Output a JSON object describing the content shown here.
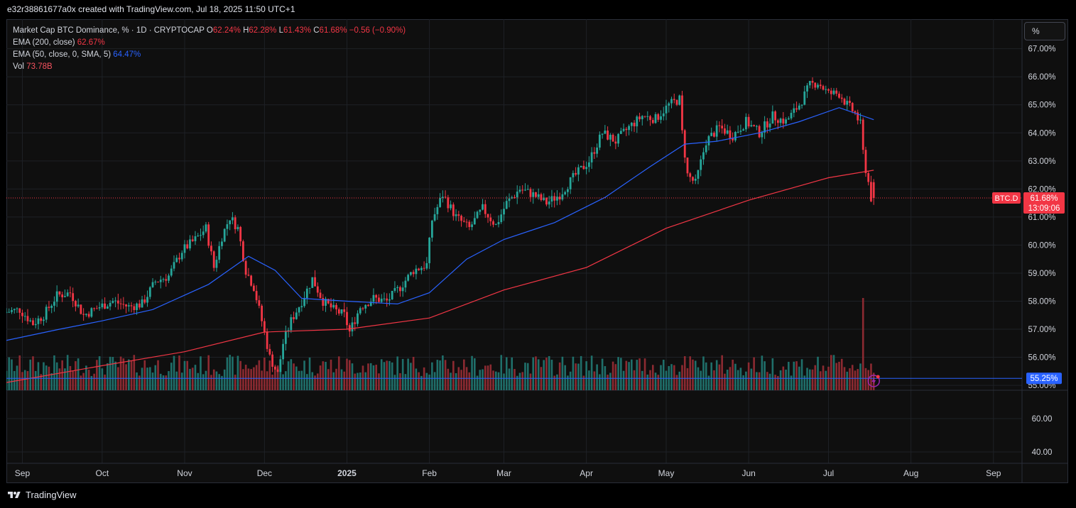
{
  "header": {
    "caption": "e32r38861677a0x created with TradingView.com, Jul 18, 2025 11:50 UTC+1"
  },
  "legend": {
    "symbol": "Market Cap BTC Dominance, % · 1D · CRYPTOCAP",
    "o_label": "O",
    "o_value": "62.24%",
    "h_label": "H",
    "h_value": "62.28%",
    "l_label": "L",
    "l_value": "61.43%",
    "c_label": "C",
    "c_value": "61.68%",
    "change": "−0.56 (−0.90%)",
    "ema200_label": "EMA (200, close)",
    "ema200_value": "62.67%",
    "ema50_label": "EMA (50, close, 0, SMA, 5)",
    "ema50_value": "64.47%",
    "vol_label": "Vol",
    "vol_value": "73.78B"
  },
  "unit_button": "%",
  "footer": {
    "brand": "TradingView"
  },
  "colors": {
    "up": "#26a69a",
    "down": "#f23645",
    "ema200": "#f23645",
    "ema50": "#2962ff",
    "hline": "#2962ff",
    "vol_up": "#1f6f6a",
    "vol_down": "#8c2a31",
    "grid": "#1e2126"
  },
  "chart_data": {
    "type": "candlestick",
    "title": "Market Cap BTC Dominance, % · 1D · CRYPTOCAP",
    "y_axis": {
      "unit": "%",
      "range": [
        54.8,
        67.7
      ],
      "ticks": [
        "67.00%",
        "66.00%",
        "65.00%",
        "64.00%",
        "63.00%",
        "62.00%",
        "61.00%",
        "60.00%",
        "59.00%",
        "58.00%",
        "57.00%",
        "56.00%",
        "55.00%"
      ]
    },
    "x_axis": {
      "labels": [
        "Sep",
        "Oct",
        "Nov",
        "Dec",
        "2025",
        "Feb",
        "Mar",
        "Apr",
        "May",
        "Jun",
        "Jul",
        "Aug",
        "Sep"
      ],
      "bold": [
        "2025"
      ]
    },
    "price_path": [
      [
        "2024-08-26",
        57.6
      ],
      [
        "2024-09-01",
        57.7
      ],
      [
        "2024-09-06",
        57.2
      ],
      [
        "2024-09-10",
        57.5
      ],
      [
        "2024-09-15",
        58.2
      ],
      [
        "2024-09-20",
        58.3
      ],
      [
        "2024-09-25",
        57.5
      ],
      [
        "2024-10-01",
        57.8
      ],
      [
        "2024-10-06",
        58.0
      ],
      [
        "2024-10-12",
        57.8
      ],
      [
        "2024-10-17",
        57.9
      ],
      [
        "2024-10-22",
        58.7
      ],
      [
        "2024-10-27",
        58.9
      ],
      [
        "2024-11-01",
        59.8
      ],
      [
        "2024-11-06",
        60.2
      ],
      [
        "2024-11-10",
        60.6
      ],
      [
        "2024-11-13",
        59.2
      ],
      [
        "2024-11-16",
        60.3
      ],
      [
        "2024-11-19",
        61.0
      ],
      [
        "2024-11-22",
        60.6
      ],
      [
        "2024-11-25",
        59.1
      ],
      [
        "2024-11-28",
        58.5
      ],
      [
        "2024-12-01",
        57.3
      ],
      [
        "2024-12-04",
        56.0
      ],
      [
        "2024-12-07",
        55.4
      ],
      [
        "2024-12-09",
        56.5
      ],
      [
        "2024-12-12",
        57.3
      ],
      [
        "2024-12-16",
        58.0
      ],
      [
        "2024-12-20",
        58.8
      ],
      [
        "2024-12-24",
        58.0
      ],
      [
        "2024-12-28",
        57.7
      ],
      [
        "2025-01-01",
        57.5
      ],
      [
        "2025-01-03",
        56.9
      ],
      [
        "2025-01-07",
        57.8
      ],
      [
        "2025-01-12",
        58.1
      ],
      [
        "2025-01-17",
        58.0
      ],
      [
        "2025-01-22",
        58.5
      ],
      [
        "2025-01-27",
        59.1
      ],
      [
        "2025-02-01",
        59.3
      ],
      [
        "2025-02-03",
        60.9
      ],
      [
        "2025-02-07",
        61.8
      ],
      [
        "2025-02-12",
        61.0
      ],
      [
        "2025-02-17",
        60.6
      ],
      [
        "2025-02-22",
        61.3
      ],
      [
        "2025-02-27",
        60.7
      ],
      [
        "2025-03-03",
        61.5
      ],
      [
        "2025-03-08",
        62.0
      ],
      [
        "2025-03-13",
        61.8
      ],
      [
        "2025-03-18",
        61.5
      ],
      [
        "2025-03-23",
        61.8
      ],
      [
        "2025-03-28",
        62.4
      ],
      [
        "2025-04-03",
        63.0
      ],
      [
        "2025-04-08",
        64.0
      ],
      [
        "2025-04-13",
        63.7
      ],
      [
        "2025-04-18",
        64.2
      ],
      [
        "2025-04-23",
        64.6
      ],
      [
        "2025-04-28",
        64.5
      ],
      [
        "2025-05-03",
        65.0
      ],
      [
        "2025-05-07",
        65.2
      ],
      [
        "2025-05-08",
        64.0
      ],
      [
        "2025-05-10",
        62.5
      ],
      [
        "2025-05-13",
        62.2
      ],
      [
        "2025-05-17",
        63.7
      ],
      [
        "2025-05-22",
        64.2
      ],
      [
        "2025-05-27",
        63.9
      ],
      [
        "2025-06-01",
        64.4
      ],
      [
        "2025-06-06",
        64.0
      ],
      [
        "2025-06-11",
        64.6
      ],
      [
        "2025-06-16",
        64.4
      ],
      [
        "2025-06-21",
        65.0
      ],
      [
        "2025-06-25",
        65.7
      ],
      [
        "2025-06-28",
        65.8
      ],
      [
        "2025-07-02",
        65.4
      ],
      [
        "2025-07-06",
        65.4
      ],
      [
        "2025-07-09",
        65.0
      ],
      [
        "2025-07-12",
        64.7
      ],
      [
        "2025-07-14",
        64.3
      ],
      [
        "2025-07-15",
        63.3
      ],
      [
        "2025-07-16",
        62.7
      ],
      [
        "2025-07-17",
        62.24
      ],
      [
        "2025-07-18",
        61.68
      ]
    ],
    "ema200_path": [
      [
        "2024-08-26",
        55.1
      ],
      [
        "2024-10-01",
        55.7
      ],
      [
        "2024-11-01",
        56.2
      ],
      [
        "2024-12-01",
        56.9
      ],
      [
        "2025-01-01",
        57.0
      ],
      [
        "2025-02-01",
        57.4
      ],
      [
        "2025-03-01",
        58.4
      ],
      [
        "2025-04-01",
        59.2
      ],
      [
        "2025-05-01",
        60.6
      ],
      [
        "2025-06-01",
        61.6
      ],
      [
        "2025-07-01",
        62.4
      ],
      [
        "2025-07-18",
        62.67
      ]
    ],
    "ema50_path": [
      [
        "2024-08-26",
        56.6
      ],
      [
        "2024-09-15",
        57.0
      ],
      [
        "2024-10-01",
        57.3
      ],
      [
        "2024-10-20",
        57.7
      ],
      [
        "2024-11-10",
        58.6
      ],
      [
        "2024-11-25",
        59.6
      ],
      [
        "2024-12-05",
        59.1
      ],
      [
        "2024-12-15",
        58.1
      ],
      [
        "2025-01-01",
        58.0
      ],
      [
        "2025-01-20",
        57.9
      ],
      [
        "2025-02-01",
        58.3
      ],
      [
        "2025-02-15",
        59.5
      ],
      [
        "2025-03-01",
        60.2
      ],
      [
        "2025-03-20",
        60.8
      ],
      [
        "2025-04-08",
        61.7
      ],
      [
        "2025-04-25",
        62.8
      ],
      [
        "2025-05-08",
        63.6
      ],
      [
        "2025-05-20",
        63.7
      ],
      [
        "2025-06-05",
        64.0
      ],
      [
        "2025-06-20",
        64.4
      ],
      [
        "2025-07-05",
        64.9
      ],
      [
        "2025-07-18",
        64.47
      ]
    ],
    "last": {
      "open": 62.24,
      "high": 62.28,
      "low": 61.43,
      "close": 61.68,
      "symbol_label": "BTC.D",
      "price_label": "61.68%",
      "countdown": "13:09:06"
    },
    "horizontal_line": {
      "value": 55.25,
      "label": "55.25%"
    },
    "volume_panel": {
      "axis_ticks": [
        "60.00",
        "40.00"
      ],
      "peak_date": "2025-07-14"
    }
  }
}
